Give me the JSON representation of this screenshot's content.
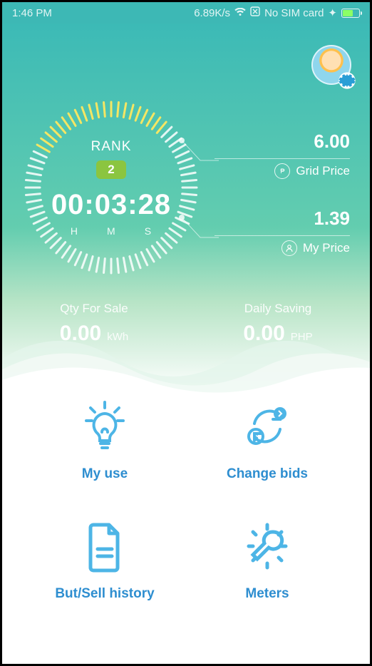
{
  "statusbar": {
    "time": "1:46 PM",
    "speed": "6.89K/s",
    "sim": "No SIM card"
  },
  "dial": {
    "rank_label": "RANK",
    "rank_value": "2",
    "timer": "00:03:28",
    "h": "H",
    "m": "M",
    "s": "S"
  },
  "prices": {
    "grid": {
      "value": "6.00",
      "label": "Grid Price"
    },
    "my": {
      "value": "1.39",
      "label": "My Price"
    }
  },
  "stats": {
    "qty": {
      "label": "Qty For Sale",
      "value": "0.00",
      "unit": "kWh"
    },
    "save": {
      "label": "Daily Saving",
      "value": "0.00",
      "unit": "PHP"
    }
  },
  "menu": {
    "myuse": "My use",
    "bids": "Change bids",
    "history": "But/Sell history",
    "meters": "Meters"
  }
}
